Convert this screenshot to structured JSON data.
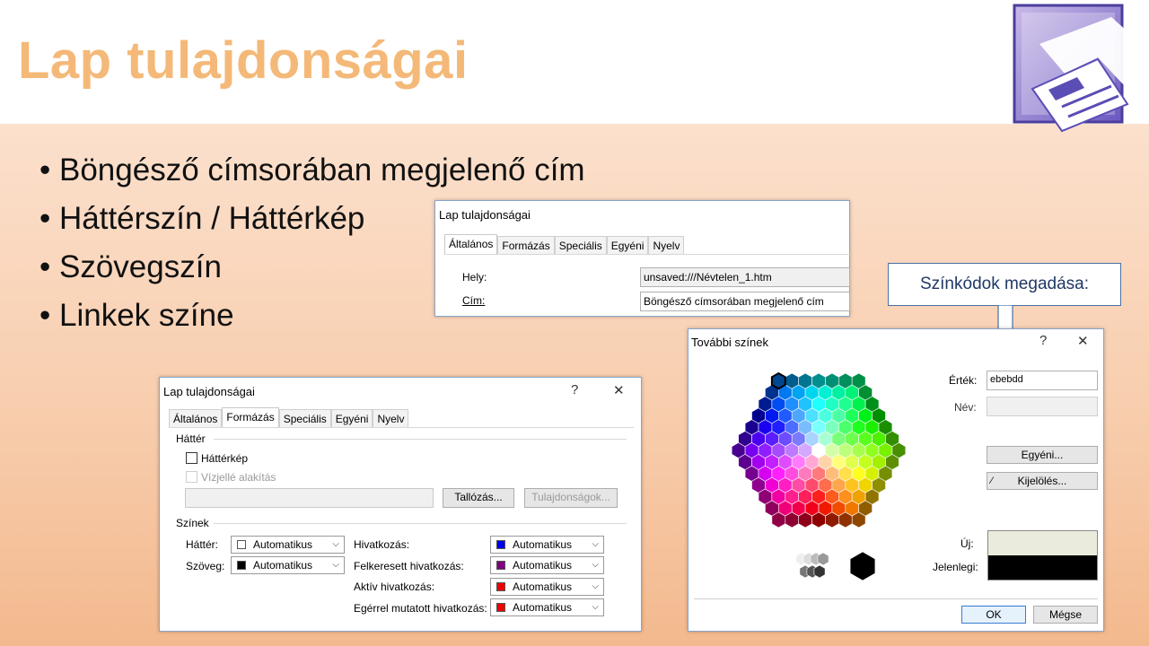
{
  "slide": {
    "title": "Lap tulajdonságai",
    "bullets": [
      "Böngésző címsorában megjelenő cím",
      "Háttérszín / Háttérkép",
      "Szövegszín",
      "Linkek színe"
    ],
    "callout": "Színkódok megadása:"
  },
  "dialog1": {
    "title": "Lap tulajdonságai",
    "tabs": [
      "Általános",
      "Formázás",
      "Speciális",
      "Egyéni",
      "Nyelv"
    ],
    "hely_label": "Hely:",
    "hely_value": "unsaved:///Névtelen_1.htm",
    "cim_label": "Cím:",
    "cim_value": "Böngésző címsorában megjelenő cím"
  },
  "dialog2": {
    "title": "Lap tulajdonságai",
    "help": "?",
    "close": "✕",
    "tabs": [
      "Általános",
      "Formázás",
      "Speciális",
      "Egyéni",
      "Nyelv"
    ],
    "hatter_group": "Háttér",
    "hatterkep_label": "Háttérkép",
    "vizjel_label": "Vízjellé alakítás",
    "tallozas": "Tallózás...",
    "tulajdonsagok": "Tulajdonságok...",
    "szinek_group": "Színek",
    "hatter_label": "Háttér:",
    "szoveg_label": "Szöveg:",
    "hivatkozas_label": "Hivatkozás:",
    "felkeresett_label": "Felkeresett hivatkozás:",
    "aktiv_label": "Aktív hivatkozás:",
    "egerrel_label": "Egérrel mutatott hivatkozás:",
    "auto": "Automatikus",
    "colors": {
      "hatter": "#ffffff",
      "szoveg": "#000000",
      "hivatkozas": "#0000ee",
      "felkeresett": "#800080",
      "aktiv": "#ee0000",
      "egerrel": "#ee0000"
    }
  },
  "dialog3": {
    "title": "További színek",
    "help": "?",
    "close": "✕",
    "ertek_label": "Érték:",
    "ertek_value": "ebebdd",
    "nev_label": "Név:",
    "egyeni": "Egyéni...",
    "kijeloles": "Kijelölés...",
    "uj_label": "Új:",
    "jelenlegi_label": "Jelenlegi:",
    "uj_color": "#ebebdd",
    "jelenlegi_color": "#000000",
    "ok": "OK",
    "megse": "Mégse"
  }
}
